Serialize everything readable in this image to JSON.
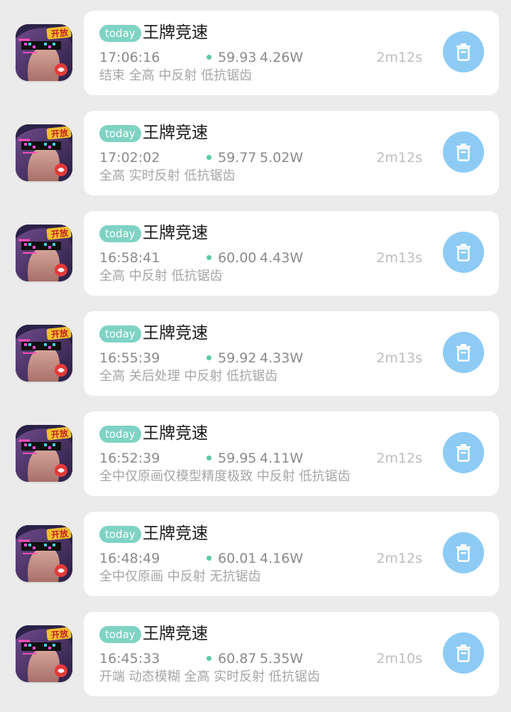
{
  "sessions": [
    {
      "badge": "today",
      "app_name": "王牌竞速",
      "icon": "game-app-icon",
      "time": "17:06:16",
      "fps": "59.93",
      "power": "4.26W",
      "duration": "2m12s",
      "settings": "结束 全高 中反射 低抗锯齿"
    },
    {
      "badge": "today",
      "app_name": "王牌竞速",
      "icon": "game-app-icon",
      "time": "17:02:02",
      "fps": "59.77",
      "power": "5.02W",
      "duration": "2m12s",
      "settings": "全高 实时反射 低抗锯齿"
    },
    {
      "badge": "today",
      "app_name": "王牌竞速",
      "icon": "game-app-icon",
      "time": "16:58:41",
      "fps": "60.00",
      "power": "4.43W",
      "duration": "2m13s",
      "settings": "全高 中反射 低抗锯齿"
    },
    {
      "badge": "today",
      "app_name": "王牌竞速",
      "icon": "game-app-icon",
      "time": "16:55:39",
      "fps": "59.92",
      "power": "4.33W",
      "duration": "2m13s",
      "settings": "全高 关后处理 中反射 低抗锯齿"
    },
    {
      "badge": "today",
      "app_name": "王牌竞速",
      "icon": "game-app-icon",
      "time": "16:52:39",
      "fps": "59.95",
      "power": "4.11W",
      "duration": "2m12s",
      "settings": "全中仅原画仅模型精度极致 中反射 低抗锯齿"
    },
    {
      "badge": "today",
      "app_name": "王牌竞速",
      "icon": "game-app-icon",
      "time": "16:48:49",
      "fps": "60.01",
      "power": "4.16W",
      "duration": "2m12s",
      "settings": "全中仅原画 中反射 无抗锯齿"
    },
    {
      "badge": "today",
      "app_name": "王牌竞速",
      "icon": "game-app-icon",
      "time": "16:45:33",
      "fps": "60.87",
      "power": "5.35W",
      "duration": "2m10s",
      "settings": "开端 动态模糊 全高 实时反射 低抗锯齿"
    }
  ],
  "icon_logo_text": "开放",
  "delete_icon": "trash-icon",
  "colors": {
    "background": "#ebebeb",
    "card": "#ffffff",
    "badge": "#7fd3c3",
    "fps_dot": "#5ec9a3",
    "delete_button": "#8dcbf5"
  }
}
